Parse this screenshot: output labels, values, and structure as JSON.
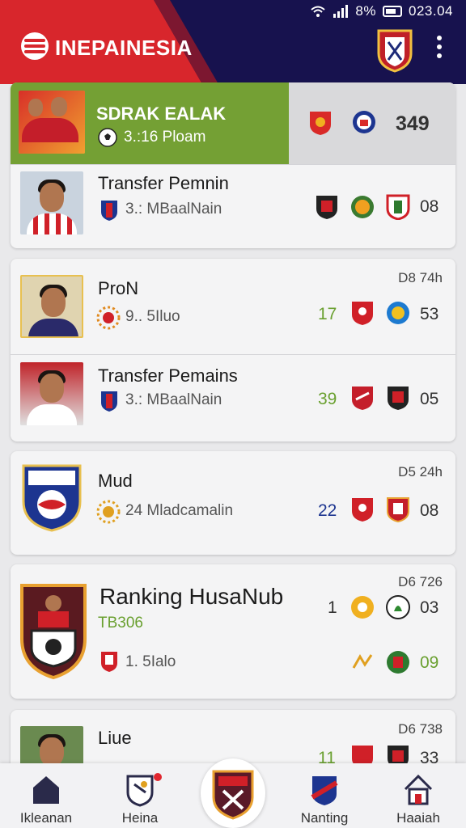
{
  "status_bar": {
    "battery": "8%",
    "time": "023.04"
  },
  "header": {
    "title": "INEPAINESIA"
  },
  "featured": {
    "name": "SDRAK EALAK",
    "sub": "3.:16 Ploam",
    "score": "349"
  },
  "cards": [
    {
      "name": "Transfer Pemnin",
      "sub": "3.: MBaalNain",
      "score": "08"
    },
    {
      "name": "ProN",
      "sub": "9.. 5Iluo",
      "meta": "D8 74h",
      "num": "17",
      "score": "53"
    },
    {
      "name": "Transfer Pemains",
      "sub": "3.: MBaalNain",
      "num": "39",
      "score": "05"
    },
    {
      "name": "Mud",
      "sub": "24 Mladcamalin",
      "meta": "D5 24h",
      "num": "22",
      "score": "08"
    },
    {
      "name": "Ranking HusaNub",
      "sub_green": "TB306",
      "sub": "1. 5Ialo",
      "meta": "D6 726",
      "num": "1",
      "score": "03",
      "score2": "09"
    },
    {
      "name": "Liue",
      "meta": "D6 738",
      "num": "11",
      "score": "33"
    }
  ],
  "nav": [
    {
      "label": "Ikleanan",
      "icon": "home-icon"
    },
    {
      "label": "Heina",
      "icon": "ball-icon"
    },
    {
      "label": "Nanting",
      "icon": "shield-icon"
    },
    {
      "label": "Haaiah",
      "icon": "house-icon"
    }
  ],
  "colors": {
    "header_bg": "#17124e",
    "brand_red": "#d8262c",
    "featured_green": "#74a034",
    "num_green": "#6aa030",
    "num_blue": "#1d3590"
  }
}
